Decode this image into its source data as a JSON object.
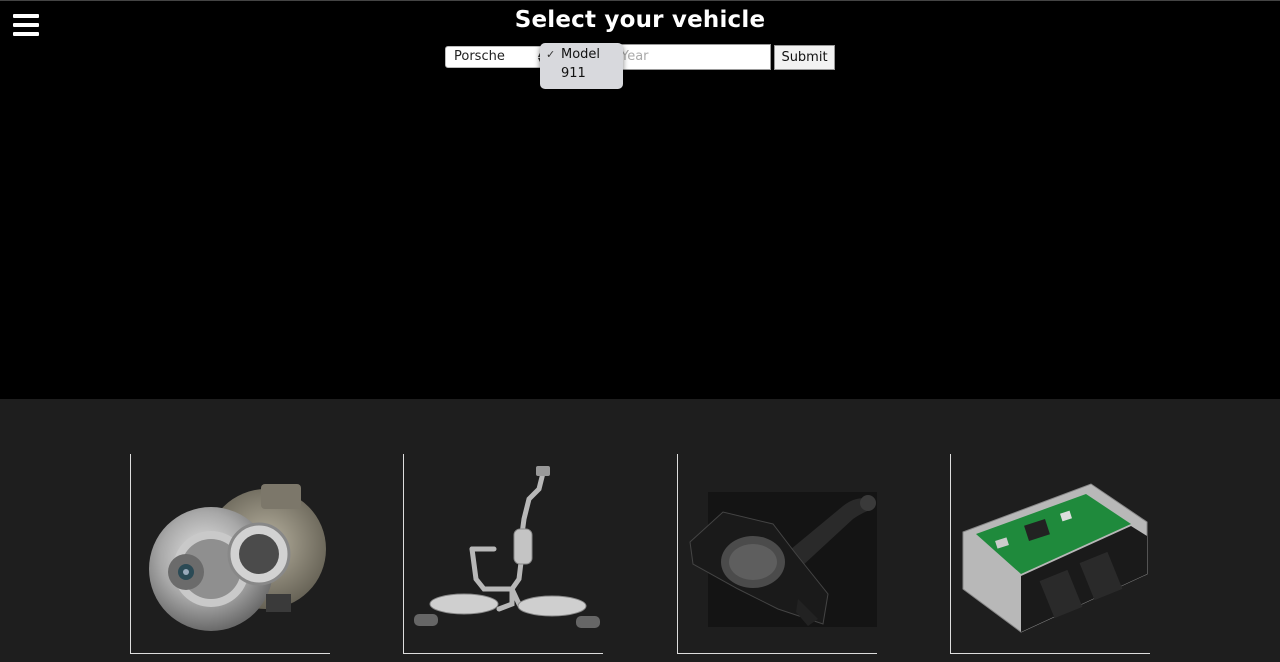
{
  "header": {
    "title": "Select your vehicle",
    "menu_icon": "hamburger-menu-icon"
  },
  "vehicle_form": {
    "make_value": "Porsche",
    "model_options": [
      "Model",
      "911"
    ],
    "model_selected": "Model",
    "year_placeholder": "Year",
    "submit_label": "Submit"
  },
  "categories": [
    {
      "icon": "turbocharger-image"
    },
    {
      "icon": "exhaust-system-image"
    },
    {
      "icon": "cold-air-intake-image"
    },
    {
      "icon": "ecu-module-image"
    }
  ]
}
